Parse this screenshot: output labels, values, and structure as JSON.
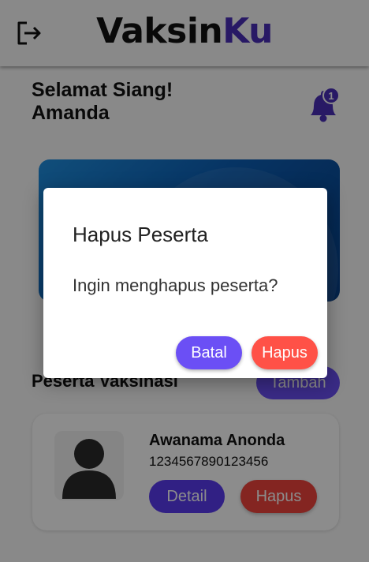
{
  "header": {
    "brand_part1": "Vaksin",
    "brand_part2": "Ku",
    "logout_icon": "logout-icon"
  },
  "greeting": {
    "line1": "Selamat Siang!",
    "line2": "Amanda"
  },
  "notifications": {
    "icon": "bell-icon",
    "count": "1"
  },
  "participants_section": {
    "title": "Peserta Vaksinasi",
    "add_label": "Tambah"
  },
  "participant": {
    "name": "Awanama Anonda",
    "nik": "1234567890123456",
    "detail_label": "Detail",
    "delete_label": "Hapus"
  },
  "dialog": {
    "title": "Hapus Peserta",
    "message": "Ingin menghapus peserta?",
    "cancel_label": "Batal",
    "confirm_label": "Hapus"
  },
  "colors": {
    "brand_accent": "#4a2fb8",
    "primary_button": "#6b4ff5",
    "danger_button": "#ff5147"
  }
}
